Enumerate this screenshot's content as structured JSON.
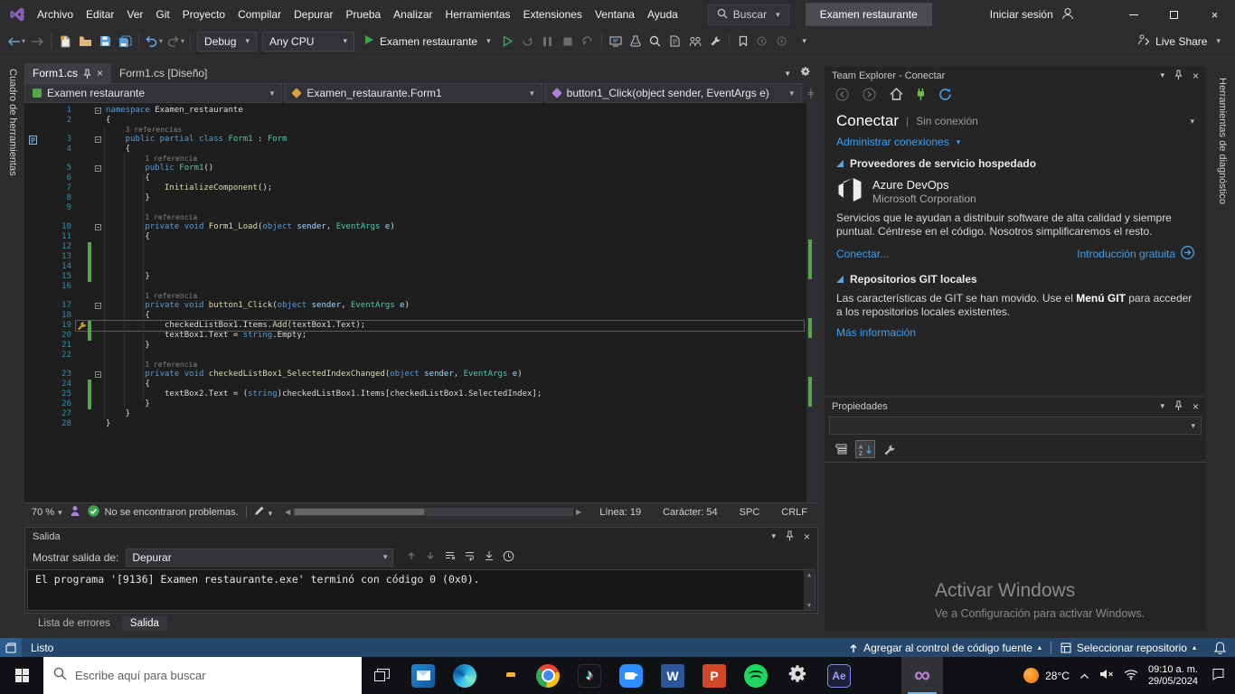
{
  "titlebar": {
    "menus": [
      "Archivo",
      "Editar",
      "Ver",
      "Git",
      "Proyecto",
      "Compilar",
      "Depurar",
      "Prueba",
      "Analizar",
      "Herramientas",
      "Extensiones",
      "Ventana",
      "Ayuda"
    ],
    "search_label": "Buscar",
    "window_title": "Examen restaurante",
    "sign_in_label": "Iniciar sesión"
  },
  "toolbar": {
    "config": "Debug",
    "platform": "Any CPU",
    "start_label": "Examen restaurante",
    "live_share_label": "Live Share",
    "icon_groups": {
      "nav": [
        "back-icon",
        "forward-icon"
      ],
      "file": [
        "new-file-icon",
        "open-file-icon",
        "save-icon",
        "save-all-icon"
      ],
      "edit": [
        "undo-icon",
        "redo-icon"
      ],
      "debug": [
        "start-without-debugging-icon",
        "hot-reload-icon",
        "break-all-icon",
        "stop-icon",
        "restart-icon"
      ],
      "tools": [
        "attach-process-icon",
        "test-explorer-icon",
        "find-in-files-icon",
        "solution-explorer-icon",
        "team-explorer-icon",
        "properties-window-icon"
      ],
      "extra": [
        "bookmark-icon",
        "navigate-backward-icon",
        "navigate-forward-icon",
        "toolbar-overflow-icon"
      ]
    }
  },
  "side_tabs": {
    "left": "Cuadro de herramientas",
    "right": "Herramientas de diagnóstico"
  },
  "editor": {
    "tabs": [
      {
        "label": "Form1.cs",
        "active": true
      },
      {
        "label": "Form1.cs [Diseño]",
        "active": false
      }
    ],
    "navbar": {
      "project": "Examen restaurante",
      "type": "Examen_restaurante.Form1",
      "member": "button1_Click(object sender, EventArgs e)"
    },
    "status": {
      "zoom": "70 %",
      "problems": "No se encontraron problemas.",
      "line": "Línea: 19",
      "column": "Carácter: 54",
      "spaces": "SPC",
      "eol": "CRLF"
    },
    "code": [
      {
        "n": 1,
        "ind": 0,
        "fold": true,
        "t": [
          [
            "k",
            "namespace"
          ],
          [
            "p",
            " Examen_restaurante"
          ]
        ]
      },
      {
        "n": 2,
        "ind": 0,
        "t": [
          [
            "p",
            "{"
          ]
        ]
      },
      {
        "lens": "3 referencias",
        "ind": 1
      },
      {
        "n": 3,
        "ind": 1,
        "fold": true,
        "gicon": "doc",
        "t": [
          [
            "k",
            "public partial class "
          ],
          [
            "t",
            "Form1"
          ],
          [
            "p",
            " : "
          ],
          [
            "t",
            "Form"
          ]
        ]
      },
      {
        "n": 4,
        "ind": 1,
        "t": [
          [
            "p",
            "{"
          ]
        ]
      },
      {
        "lens": "1 referencia",
        "ind": 2
      },
      {
        "n": 5,
        "ind": 2,
        "fold": true,
        "t": [
          [
            "k",
            "public "
          ],
          [
            "t",
            "Form1"
          ],
          [
            "p",
            "()"
          ]
        ]
      },
      {
        "n": 6,
        "ind": 2,
        "t": [
          [
            "p",
            "{"
          ]
        ]
      },
      {
        "n": 7,
        "ind": 3,
        "t": [
          [
            "m",
            "InitializeComponent"
          ],
          [
            "p",
            "();"
          ]
        ]
      },
      {
        "n": 8,
        "ind": 2,
        "t": [
          [
            "p",
            "}"
          ]
        ]
      },
      {
        "n": 9,
        "ind": 0,
        "t": []
      },
      {
        "lens": "1 referencia",
        "ind": 2
      },
      {
        "n": 10,
        "ind": 2,
        "fold": true,
        "t": [
          [
            "k",
            "private void "
          ],
          [
            "m",
            "Form1_Load"
          ],
          [
            "p",
            "("
          ],
          [
            "k",
            "object"
          ],
          [
            "pr",
            " sender"
          ],
          [
            "p",
            ", "
          ],
          [
            "t",
            "EventArgs"
          ],
          [
            "pr",
            " e"
          ],
          [
            "p",
            ")"
          ]
        ]
      },
      {
        "n": 11,
        "ind": 2,
        "t": [
          [
            "p",
            "{"
          ]
        ]
      },
      {
        "n": 12,
        "ind": 0,
        "mark": true,
        "t": []
      },
      {
        "n": 13,
        "ind": 0,
        "mark": true,
        "t": []
      },
      {
        "n": 14,
        "ind": 0,
        "mark": true,
        "t": []
      },
      {
        "n": 15,
        "ind": 2,
        "mark": true,
        "t": [
          [
            "p",
            "}"
          ]
        ]
      },
      {
        "n": 16,
        "ind": 0,
        "t": []
      },
      {
        "lens": "1 referencia",
        "ind": 2
      },
      {
        "n": 17,
        "ind": 2,
        "fold": true,
        "t": [
          [
            "k",
            "private void "
          ],
          [
            "m",
            "button1_Click"
          ],
          [
            "p",
            "("
          ],
          [
            "k",
            "object"
          ],
          [
            "pr",
            " sender"
          ],
          [
            "p",
            ", "
          ],
          [
            "t",
            "EventArgs"
          ],
          [
            "pr",
            " e"
          ],
          [
            "p",
            ")"
          ]
        ]
      },
      {
        "n": 18,
        "ind": 2,
        "t": [
          [
            "p",
            "{"
          ]
        ]
      },
      {
        "n": 19,
        "ind": 3,
        "cur": true,
        "mark": true,
        "gicon": "wrench",
        "t": [
          [
            "p",
            "checkedListBox1.Items."
          ],
          [
            "m",
            "Add"
          ],
          [
            "p",
            "(textBox1.Text);"
          ]
        ]
      },
      {
        "n": 20,
        "ind": 3,
        "mark": true,
        "t": [
          [
            "p",
            "textBox1.Text = "
          ],
          [
            "k",
            "string"
          ],
          [
            "p",
            ".Empty;"
          ]
        ]
      },
      {
        "n": 21,
        "ind": 2,
        "t": [
          [
            "p",
            "}"
          ]
        ]
      },
      {
        "n": 22,
        "ind": 0,
        "t": []
      },
      {
        "lens": "1 referencia",
        "ind": 2
      },
      {
        "n": 23,
        "ind": 2,
        "fold": true,
        "t": [
          [
            "k",
            "private void "
          ],
          [
            "m",
            "checkedListBox1_SelectedIndexChanged"
          ],
          [
            "p",
            "("
          ],
          [
            "k",
            "object"
          ],
          [
            "pr",
            " sender"
          ],
          [
            "p",
            ", "
          ],
          [
            "t",
            "EventArgs"
          ],
          [
            "pr",
            " e"
          ],
          [
            "p",
            ")"
          ]
        ]
      },
      {
        "n": 24,
        "ind": 2,
        "mark": true,
        "t": [
          [
            "p",
            "{"
          ]
        ]
      },
      {
        "n": 25,
        "ind": 3,
        "mark": true,
        "t": [
          [
            "p",
            "textBox2.Text = ("
          ],
          [
            "k",
            "string"
          ],
          [
            "p",
            ")checkedListBox1.Items[checkedListBox1.SelectedIndex];"
          ]
        ]
      },
      {
        "n": 26,
        "ind": 2,
        "mark": true,
        "t": [
          [
            "p",
            "}"
          ]
        ]
      },
      {
        "n": 27,
        "ind": 1,
        "t": [
          [
            "p",
            "}"
          ]
        ]
      },
      {
        "n": 28,
        "ind": 0,
        "t": [
          [
            "p",
            "}"
          ]
        ]
      }
    ]
  },
  "output": {
    "title": "Salida",
    "show_output_label": "Mostrar salida de:",
    "source": "Depurar",
    "lines": [
      "El programa '[9136] Examen restaurante.exe' terminó con código 0 (0x0)."
    ],
    "tabs": [
      "Lista de errores",
      "Salida"
    ]
  },
  "team_explorer": {
    "title": "Team Explorer - Conectar",
    "heading": "Conectar",
    "status": "Sin conexión",
    "manage_link": "Administrar conexiones",
    "section1": "Proveedores de servicio hospedado",
    "azure_title": "Azure DevOps",
    "azure_sub": "Microsoft Corporation",
    "azure_desc": "Servicios que le ayudan a distribuir software de alta calidad y siempre puntual. Céntrese en el código. Nosotros simplificaremos el resto.",
    "connect_link": "Conectar...",
    "intro_link": "Introducción gratuita",
    "section2": "Repositorios GIT locales",
    "git_desc_1": "Las características de GIT se han movido. Use el ",
    "git_desc_bold": "Menú GIT",
    "git_desc_2": " para acceder a los repositorios locales existentes.",
    "more_info": "Más información"
  },
  "properties": {
    "title": "Propiedades"
  },
  "watermark": {
    "line1": "Activar Windows",
    "line2": "Ve a Configuración para activar Windows."
  },
  "statusbar": {
    "ready": "Listo",
    "source_control": "Agregar al control de código fuente",
    "select_repo": "Seleccionar repositorio"
  },
  "taskbar": {
    "search_placeholder": "Escribe aquí para buscar",
    "apps": [
      "mail-icon",
      "edge-icon",
      "file-explorer-icon",
      "chrome-icon",
      "tiktok-icon",
      "zoom-icon",
      "word-icon",
      "powerpoint-icon",
      "spotify-icon",
      "settings-icon",
      "after-effects-icon",
      "vscode-icon",
      "visual-studio-icon"
    ],
    "active_app": "visual-studio-icon",
    "tray": {
      "temperature": "28°C",
      "time": "09:10 a. m.",
      "date": "29/05/2024"
    }
  }
}
